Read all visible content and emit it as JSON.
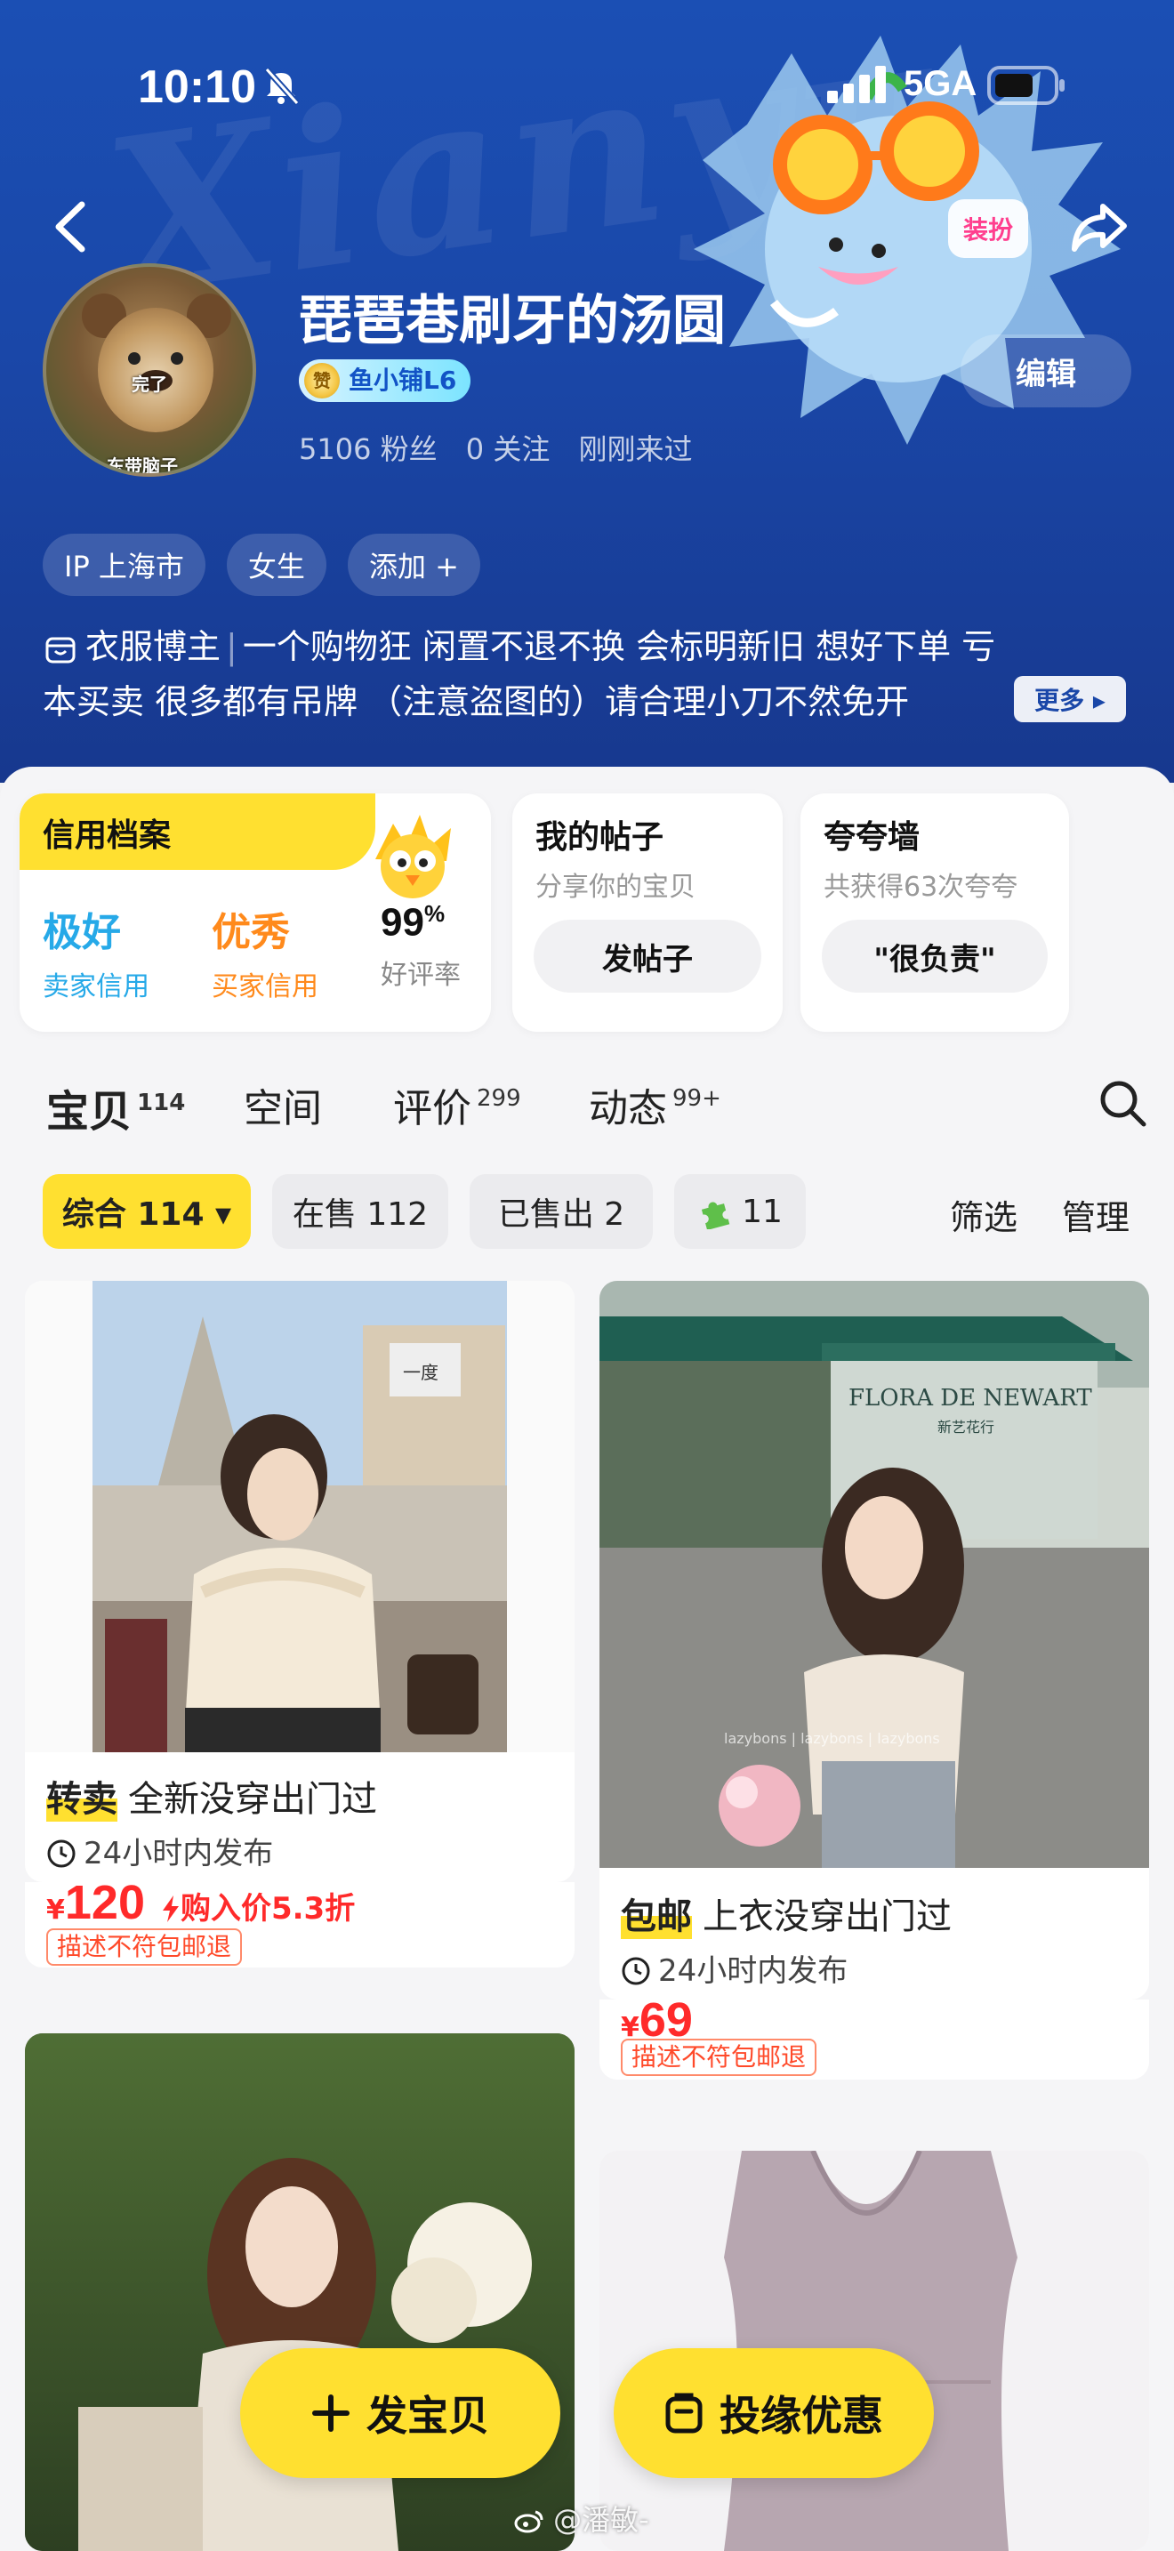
{
  "status_bar": {
    "time": "10:10",
    "network": "5GA"
  },
  "header": {
    "watermark": "Xianyu",
    "dress_up_label": "装扮",
    "avatar_caption_top": "完了",
    "avatar_caption_bottom": "东带脑子",
    "username": "琵琶巷刷牙的汤圆",
    "level_medal": "赞",
    "level": "鱼小铺L6",
    "followers": "5106 粉丝",
    "following": "0 关注",
    "last_seen": "刚刚来过",
    "edit_label": "编辑",
    "tags": [
      "IP 上海市",
      "女生",
      "添加 +"
    ],
    "bio_role": "衣服博主",
    "bio_line1": "一个购物狂  闲置不退不换  会标明新旧  想好下单  亏",
    "bio_line2": "本买卖  很多都有吊牌  （注意盗图的）请合理小刀不然免开",
    "more_label": "更多 ▸"
  },
  "cards": {
    "credit": {
      "title": "信用档案",
      "seller_grade": "极好",
      "seller_label": "卖家信用",
      "buyer_grade": "优秀",
      "buyer_label": "买家信用",
      "rating_value": "99",
      "rating_unit": "%",
      "rating_label": "好评率"
    },
    "posts": {
      "title": "我的帖子",
      "subtitle": "分享你的宝贝",
      "button": "发帖子"
    },
    "praise": {
      "title": "夸夸墙",
      "subtitle": "共获得63次夸夸",
      "button": "\"很负责\""
    }
  },
  "tabs": [
    {
      "label": "宝贝",
      "count": "114"
    },
    {
      "label": "空间",
      "count": ""
    },
    {
      "label": "评价",
      "count": "299"
    },
    {
      "label": "动态",
      "count": "99+"
    }
  ],
  "filters": {
    "all": "综合 114 ▾",
    "on_sale": "在售 112",
    "sold": "已售出 2",
    "puzzle": "11",
    "filter": "筛选",
    "manage": "管理"
  },
  "products": [
    {
      "badge": "转卖",
      "title": "全新没穿出门过",
      "time": "24小时内发布",
      "currency": "¥",
      "price": "120",
      "discount": "购入价5.3折",
      "refund": "描述不符包邮退"
    },
    {
      "badge": "包邮",
      "title": "上衣没穿出门过",
      "time": "24小时内发布",
      "currency": "¥",
      "price": "69",
      "refund": "描述不符包邮退"
    }
  ],
  "photo_texts": {
    "shop_sign": "FLORA DE NEWART",
    "shop_sub": "新艺花行",
    "watermark": "lazybons  |  lazybons  |  lazybons",
    "screen": "一度"
  },
  "fabs": {
    "post_item": "发宝贝",
    "offer": "投缘优惠"
  },
  "weibo_mark": "@潘敏-",
  "colors": {
    "accent_yellow": "#ffe030",
    "header_blue": "#1a47a8",
    "price_red": "#ff2a2a",
    "seller_blue": "#26a9e8",
    "buyer_orange": "#ff8a1c"
  }
}
